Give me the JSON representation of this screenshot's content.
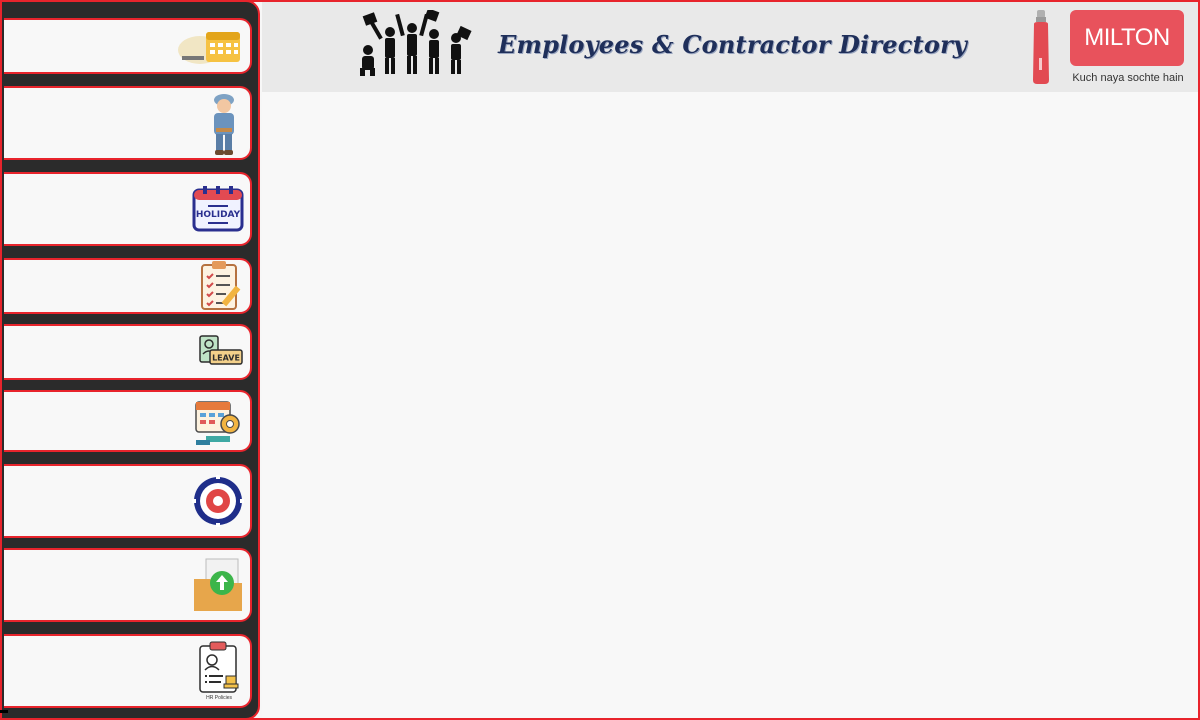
{
  "header": {
    "title": "Employees & Contractor Directory",
    "brand_name": "MILTON",
    "brand_tagline": "Kuch naya sochte hain",
    "workers_icon": "celebrating-workers-icon",
    "bottle_icon": "water-bottle-icon"
  },
  "sidebar": {
    "items": [
      {
        "label": "",
        "icon": "calendar-icon"
      },
      {
        "label": "",
        "icon": "worker-icon"
      },
      {
        "label": "",
        "icon": "holiday-calendar-icon"
      },
      {
        "label": "",
        "icon": "checklist-icon"
      },
      {
        "label": "",
        "icon": "leave-icon"
      },
      {
        "label": "",
        "icon": "schedule-settings-icon"
      },
      {
        "label": "",
        "icon": "epfo-emblem-icon"
      },
      {
        "label": "",
        "icon": "upload-folder-icon"
      },
      {
        "label": "",
        "icon": "hr-policies-icon"
      }
    ],
    "policies_caption": "HR Policies"
  },
  "colors": {
    "accent": "#e8242c",
    "sidebar_bg": "#2b2b2b",
    "title": "#1f2f5a",
    "brand": "#e8525c"
  }
}
